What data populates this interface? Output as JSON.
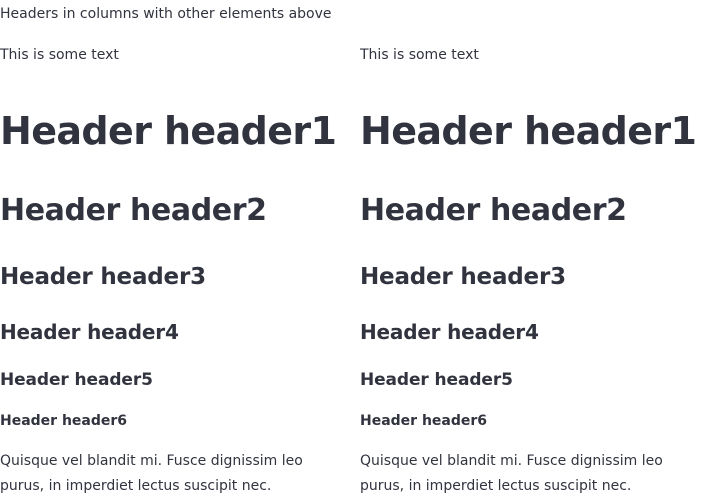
{
  "caption": "Headers in columns with other elements above",
  "columns": [
    {
      "text": "This is some text",
      "h1": "Header header1",
      "h2": "Header header2",
      "h3": "Header header3",
      "h4": "Header header4",
      "h5": "Header header5",
      "h6": "Header header6",
      "paragraph": "Quisque vel blandit mi. Fusce dignissim leo purus, in imperdiet lectus suscipit nec."
    },
    {
      "text": "This is some text",
      "h1": "Header header1",
      "h2": "Header header2",
      "h3": "Header header3",
      "h4": "Header header4",
      "h5": "Header header5",
      "h6": "Header header6",
      "paragraph": "Quisque vel blandit mi. Fusce dignissim leo purus, in imperdiet lectus suscipit nec."
    }
  ]
}
